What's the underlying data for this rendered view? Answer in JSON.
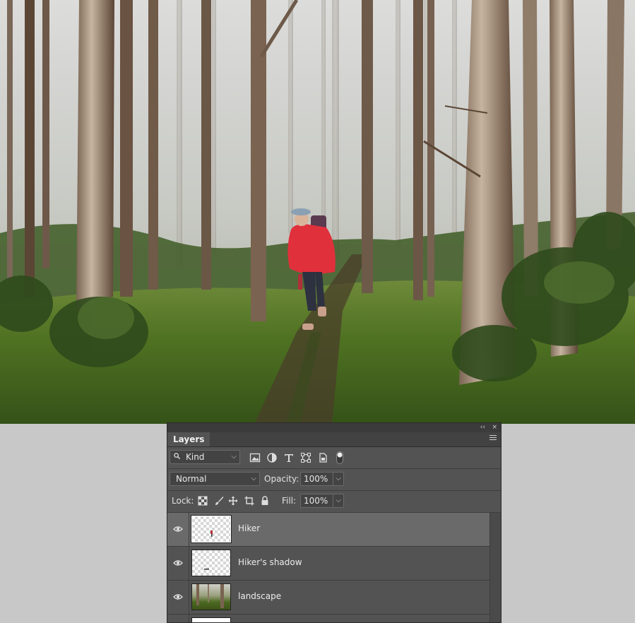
{
  "panel": {
    "tab_label": "Layers",
    "collapse_glyph": "‹‹",
    "close_glyph": "×",
    "filter": {
      "kind_label": "Kind",
      "icons": [
        "image-filter-icon",
        "adjustment-filter-icon",
        "type-filter-icon",
        "shape-filter-icon",
        "smart-object-filter-icon",
        "filter-toggle-icon"
      ]
    },
    "blend": {
      "mode": "Normal",
      "opacity_label": "Opacity:",
      "opacity_value": "100%"
    },
    "lock": {
      "label": "Lock:",
      "icons": [
        "lock-transparent-pixels-icon",
        "lock-image-pixels-icon",
        "lock-position-icon",
        "lock-artboard-icon",
        "lock-all-icon"
      ],
      "fill_label": "Fill:",
      "fill_value": "100%"
    },
    "layers": [
      {
        "name": "Hiker",
        "selected": true,
        "visible": true,
        "thumb": "transparent"
      },
      {
        "name": "Hiker's shadow",
        "selected": false,
        "visible": true,
        "thumb": "transparent"
      },
      {
        "name": "landscape",
        "selected": false,
        "visible": true,
        "thumb": "photo"
      },
      {
        "name": "",
        "selected": false,
        "visible": true,
        "thumb": "white"
      }
    ]
  }
}
